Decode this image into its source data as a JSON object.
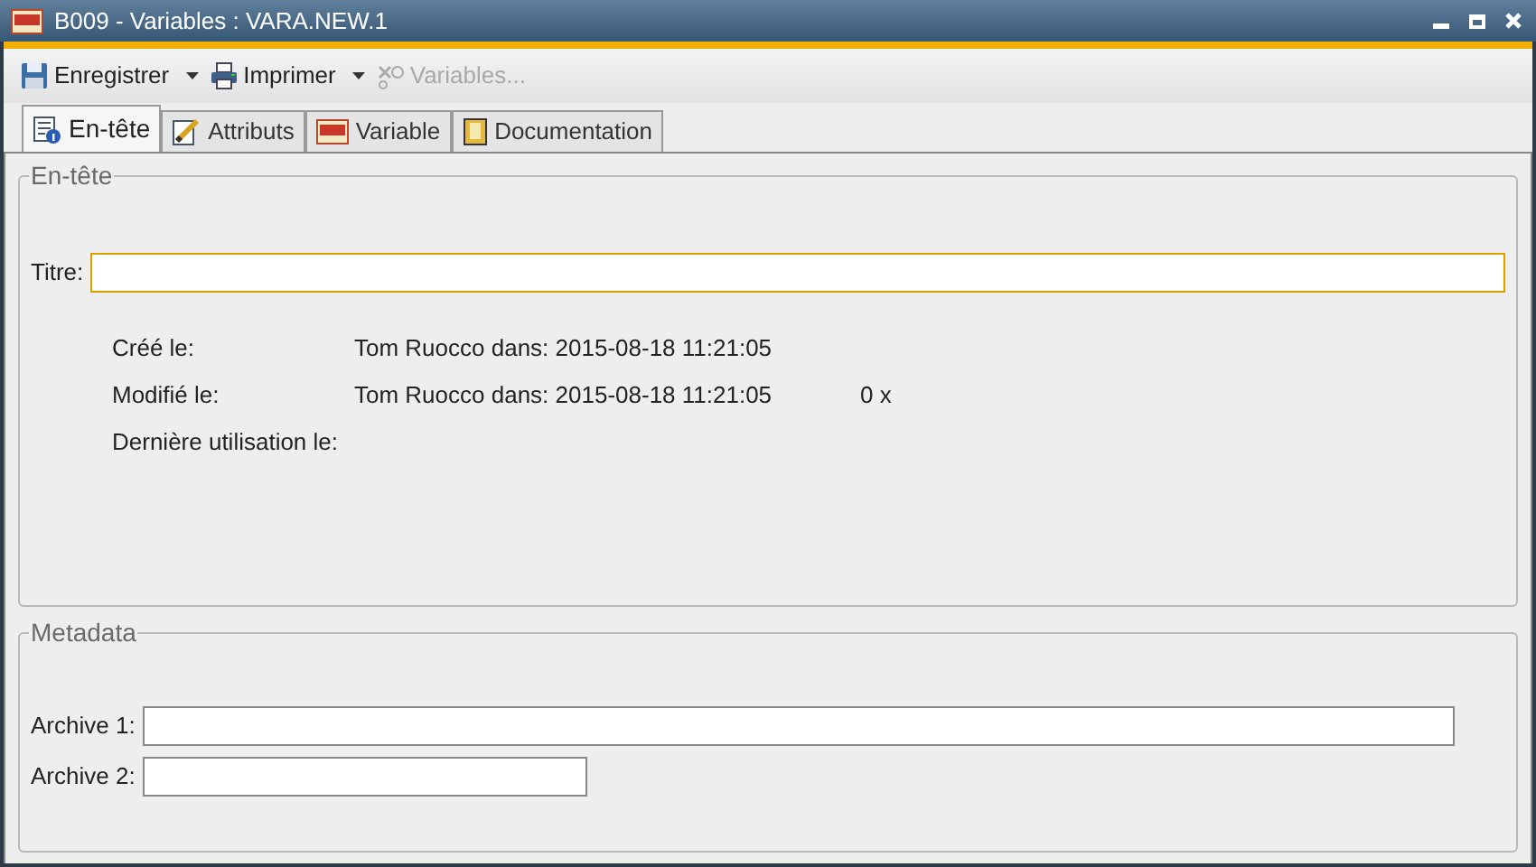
{
  "window": {
    "title": "B009 - Variables : VARA.NEW.1"
  },
  "toolbar": [
    {
      "label": "Enregistrer",
      "has_menu": true,
      "disabled": false
    },
    {
      "label": "Imprimer",
      "has_menu": true,
      "disabled": false
    },
    {
      "label": "Variables...",
      "has_menu": false,
      "disabled": true
    }
  ],
  "tabs": [
    {
      "label": "En-tête",
      "selected": true
    },
    {
      "label": "Attributs",
      "selected": false
    },
    {
      "label": "Variable",
      "selected": false
    },
    {
      "label": "Documentation",
      "selected": false
    }
  ],
  "header_section": {
    "legend": "En-tête",
    "title_label": "Titre:",
    "title_focused": true,
    "info": [
      {
        "label": "Créé le:",
        "value": "Tom Ruocco dans: 2015-08-18 11:21:05"
      },
      {
        "label": "Modifié le:",
        "value": "Tom Ruocco dans: 2015-08-18 11:21:05",
        "count": "0 x"
      },
      {
        "label": "Dernière utilisation le:"
      }
    ]
  },
  "metadata_section": {
    "legend": "Metadata",
    "fields": [
      {
        "label": "Archive 1:"
      },
      {
        "label": "Archive 2:"
      }
    ]
  }
}
